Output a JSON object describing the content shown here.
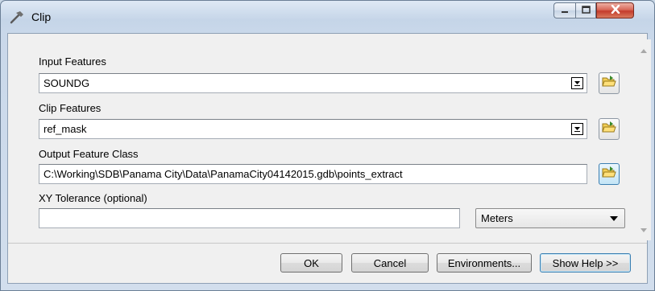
{
  "window": {
    "title": "Clip",
    "icon": "hammer-icon",
    "controls": {
      "minimize": "minimize-icon",
      "maximize": "maximize-icon",
      "close": "close-icon"
    }
  },
  "form": {
    "input_features": {
      "label": "Input Features",
      "value": "SOUNDG"
    },
    "clip_features": {
      "label": "Clip Features",
      "value": "ref_mask"
    },
    "output_feature_class": {
      "label": "Output Feature Class",
      "value": "C:\\Working\\SDB\\Panama City\\Data\\PanamaCity04142015.gdb\\points_extract"
    },
    "xy_tolerance": {
      "label": "XY Tolerance (optional)",
      "value": "",
      "unit": "Meters"
    }
  },
  "buttons": {
    "ok": "OK",
    "cancel": "Cancel",
    "environments": "Environments...",
    "show_help": "Show Help >>"
  },
  "colors": {
    "close_button": "#c43c2c",
    "focus_border": "#3c7fb1"
  }
}
